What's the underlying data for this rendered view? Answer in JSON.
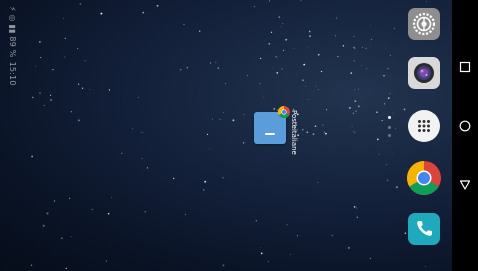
{
  "status_bar": {
    "indicators": "⚡ ◎ ▮▮ 89 %",
    "time": "15:10"
  },
  "desktop": {
    "shortcut": {
      "label": "Posteitaliane",
      "icon": "app-shortcut-icon",
      "badge_icon": "chrome-badge-icon",
      "color": "#5b9ddb"
    },
    "page_count": 3,
    "active_page": 1
  },
  "dock": {
    "apps": [
      {
        "name": "settings",
        "icon": "settings-gear-icon",
        "color": "#8e8e8e"
      },
      {
        "name": "camera",
        "icon": "camera-icon",
        "color": "#d9d9d9"
      },
      {
        "name": "app-drawer",
        "icon": "app-drawer-icon",
        "color": "#f2f2f2"
      },
      {
        "name": "chrome",
        "icon": "chrome-icon",
        "color": "#db4437"
      },
      {
        "name": "phone",
        "icon": "phone-icon",
        "color": "#1fa9bc"
      }
    ]
  },
  "navigation": {
    "buttons": [
      "recent-apps-icon",
      "home-icon",
      "back-icon"
    ]
  },
  "colors": {
    "wallpaper": "#13203a",
    "nav_bar": "#000000"
  }
}
